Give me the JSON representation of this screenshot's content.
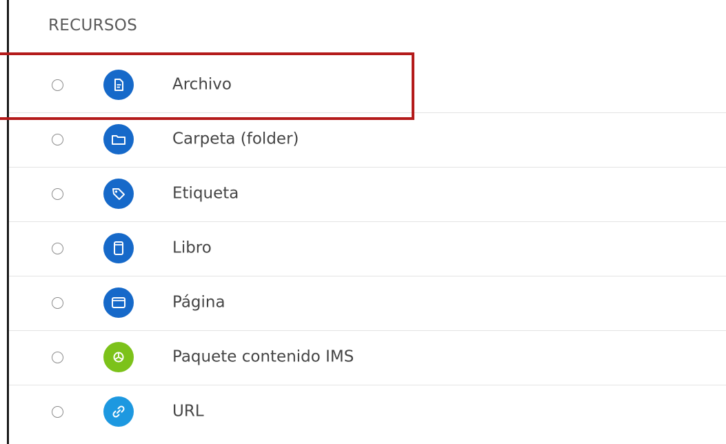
{
  "section": {
    "heading": "RECURSOS"
  },
  "colors": {
    "icon_blue": "#1669c9",
    "icon_green": "#7cc21a",
    "icon_light_blue": "#1d98e0",
    "highlight_red": "#b41b1b"
  },
  "resources": [
    {
      "label": "Archivo",
      "icon": "file-icon",
      "selected": false,
      "highlighted": true
    },
    {
      "label": "Carpeta (folder)",
      "icon": "folder-icon",
      "selected": false,
      "highlighted": false
    },
    {
      "label": "Etiqueta",
      "icon": "tag-icon",
      "selected": false,
      "highlighted": false
    },
    {
      "label": "Libro",
      "icon": "book-icon",
      "selected": false,
      "highlighted": false
    },
    {
      "label": "Página",
      "icon": "page-icon",
      "selected": false,
      "highlighted": false
    },
    {
      "label": "Paquete contenido IMS",
      "icon": "ims-package-icon",
      "selected": false,
      "highlighted": false
    },
    {
      "label": "URL",
      "icon": "link-icon",
      "selected": false,
      "highlighted": false
    }
  ]
}
